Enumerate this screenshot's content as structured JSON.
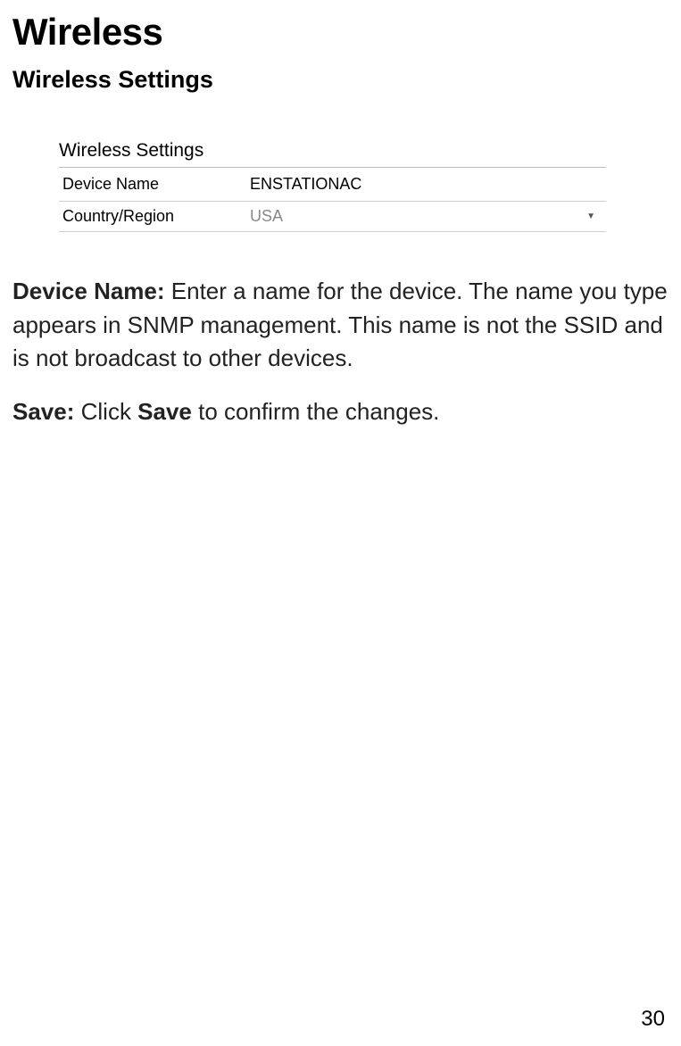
{
  "page": {
    "title": "Wireless",
    "section_title": "Wireless Settings",
    "page_number": "30"
  },
  "settings_panel": {
    "heading": "Wireless Settings",
    "rows": {
      "device_name_label": "Device Name",
      "device_name_value": "ENSTATIONAC",
      "country_label": "Country/Region",
      "country_value": "USA"
    }
  },
  "descriptions": {
    "d1_label": "Device Name:",
    "d1_text": " Enter a name for the device. The name you type appears in SNMP management. This name is not the SSID and is not broadcast to other devices.",
    "d2_label": "Save:",
    "d2_text_a": " Click ",
    "d2_bold": "Save",
    "d2_text_b": " to confirm the changes."
  }
}
